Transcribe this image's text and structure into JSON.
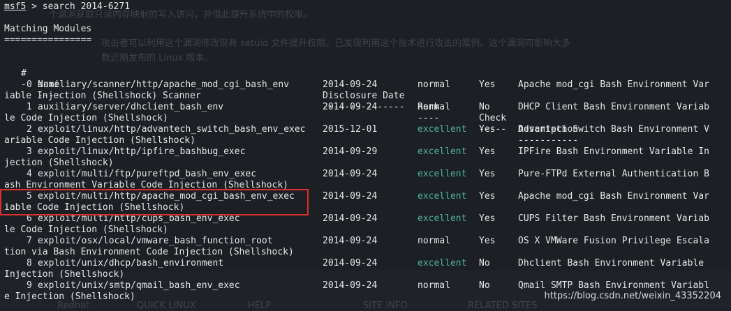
{
  "prompt": {
    "name": "msf5",
    "command": " > search 2014-6271"
  },
  "heading": {
    "title": "Matching Modules",
    "underline": "================"
  },
  "columns": {
    "num": "#",
    "name": "Name",
    "date": "Disclosure Date",
    "rank": "Rank",
    "check": "Check",
    "desc": "Description"
  },
  "separators": {
    "num": "-",
    "name": "----",
    "date": "---------------",
    "rank": "----",
    "check": "-----",
    "desc": "-----------"
  },
  "rows": [
    {
      "num": "0",
      "name1": "auxiliary/scanner/http/apache_mod_cgi_bash_env",
      "name2": "iable Injection (Shellshock) Scanner",
      "date": "2014-09-24",
      "rank": "normal",
      "check": "Yes",
      "desc": "Apache mod_cgi Bash Environment Var"
    },
    {
      "num": "1",
      "name1": "auxiliary/server/dhclient_bash_env",
      "name2": "le Code Injection (Shellshock)",
      "date": "2014-09-24",
      "rank": "normal",
      "check": "No",
      "desc": "DHCP Client Bash Environment Variab"
    },
    {
      "num": "2",
      "name1": "exploit/linux/http/advantech_switch_bash_env_exec",
      "name2": "ariable Code Injection (Shellshock)",
      "date": "2015-12-01",
      "rank": "excellent",
      "check": "Yes",
      "desc": "Advantech Switch Bash Environment V"
    },
    {
      "num": "3",
      "name1": "exploit/linux/http/ipfire_bashbug_exec",
      "name2": "jection (Shellshock)",
      "date": "2014-09-29",
      "rank": "excellent",
      "check": "Yes",
      "desc": "IPFire Bash Environment Variable In"
    },
    {
      "num": "4",
      "name1": "exploit/multi/ftp/pureftpd_bash_env_exec",
      "name2": "ash Environment Variable Code Injection (Shellshock)",
      "date": "2014-09-24",
      "rank": "excellent",
      "check": "Yes",
      "desc": "Pure-FTPd External Authentication B"
    },
    {
      "num": "5",
      "name1": "exploit/multi/http/apache_mod_cgi_bash_env_exec",
      "name2": "iable Code Injection (Shellshock)",
      "date": "2014-09-24",
      "rank": "excellent",
      "check": "Yes",
      "desc": "Apache mod_cgi Bash Environment Var"
    },
    {
      "num": "6",
      "name1": "exploit/multi/http/cups_bash_env_exec",
      "name2": "le Code Injection (Shellshock)",
      "date": "2014-09-24",
      "rank": "excellent",
      "check": "Yes",
      "desc": "CUPS Filter Bash Environment Variab"
    },
    {
      "num": "7",
      "name1": "exploit/osx/local/vmware_bash_function_root",
      "name2": "tion via Bash Environment Code Injection (Shellshock)",
      "date": "2014-09-24",
      "rank": "normal",
      "check": "Yes",
      "desc": "OS X VMWare Fusion Privilege Escala"
    },
    {
      "num": "8",
      "name1": "exploit/unix/dhcp/bash_environment",
      "name2": "Injection (Shellshock)",
      "date": "2014-09-24",
      "rank": "excellent",
      "check": "No",
      "desc": "Dhclient Bash Environment Variable"
    },
    {
      "num": "9",
      "name1": "exploit/unix/smtp/qmail_bash_env_exec",
      "name2": "e Injection (Shellshock)",
      "date": "2014-09-24",
      "rank": "normal",
      "check": "No",
      "desc": "Qmail SMTP Bash Environment Variabl"
    }
  ],
  "overlay": {
    "line1": "个漏洞获取只读内存映射的写入访问，并借此提升系统中的权限。",
    "line2": "攻击者可以利用这个漏洞修改现有 setuid 文件提升权限。已发现利用这个技术进行攻击的案例。这个漏洞可影响大多",
    "line3": "数近期发布的 Linux 版本。",
    "bottom_items": [
      "Redhat",
      "QUICK LINUX",
      "HELP",
      "SITE INFO",
      "RELATED SITES"
    ]
  },
  "watermark": "https://blog.csdn.net/weixin_43352204",
  "colors": {
    "excellent": "#4fb3a0",
    "highlight": "#d9302f",
    "background": "#1c1f24"
  }
}
